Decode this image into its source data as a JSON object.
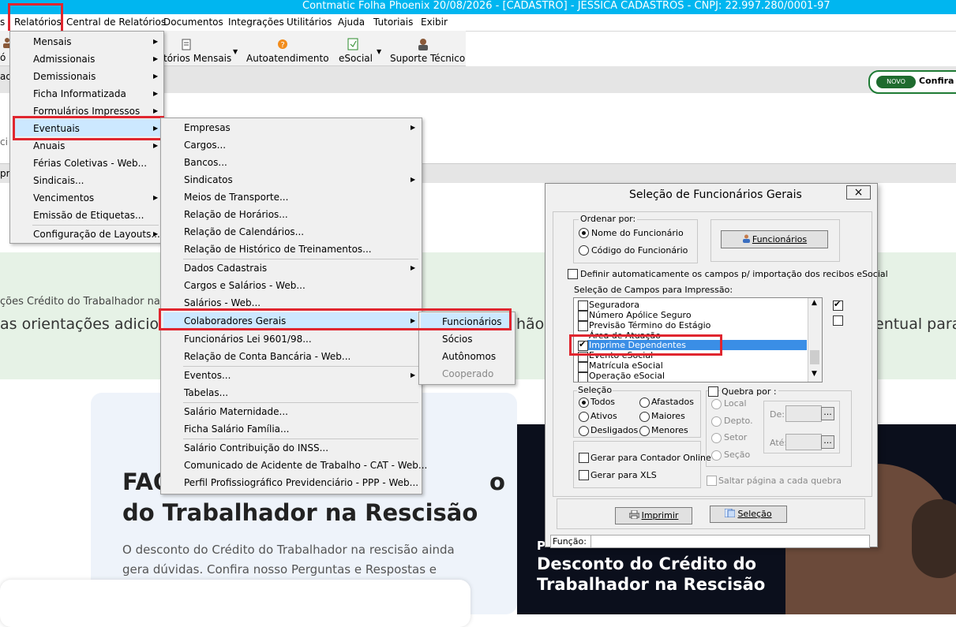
{
  "window": {
    "title": "Contmatic Folha Phoenix 20/08/2026 - [CADASTRO] - JESSICA CADASTROS - CNPJ: 22.997.280/0001-97"
  },
  "menubar": {
    "items": [
      "s",
      "Relatórios",
      "Central de Relatórios",
      "Documentos",
      "Integrações",
      "Utilitários",
      "Ajuda",
      "Tutoriais",
      "Exibir"
    ]
  },
  "toolbar": {
    "items": [
      "tórios Mensais",
      "Autoatendimento",
      "eSocial",
      "Suporte Técnico"
    ],
    "left_fragments": [
      "ó",
      "ad"
    ]
  },
  "novo": {
    "badge": "NOVO",
    "text": "Confira as"
  },
  "background": {
    "frag_ci": "ci",
    "frag_pr": "pr",
    "green_small": "ções Crédito do Trabalhador na",
    "green_big_left": "as orientações adicio",
    "green_big_mid": "hão",
    "green_big_right": "entual para",
    "faq_line1_left": "FAQ",
    "faq_line1_right": "o",
    "faq_line2": "do Trabalhador na Rescisão",
    "faq_p1": "O desconto do Crédito do Trabalhador na rescisão ainda",
    "faq_p2": "gera dúvidas. Confira nosso Perguntas e Respostas e",
    "ad_p": "P",
    "ad_line1": "Desconto do Crédito do",
    "ad_line2": "Trabalhador  na Rescisão"
  },
  "menu_relatorios": {
    "items": [
      "Mensais",
      "Admissionais",
      "Demissionais",
      "Ficha Informatizada",
      "Formulários Impressos",
      "Eventuais",
      "Anuais",
      "Férias Coletivas - Web...",
      "Sindicais...",
      "Vencimentos",
      "Emissão de Etiquetas...",
      "Configuração de Layouts..."
    ]
  },
  "menu_eventuais": {
    "items": [
      "Empresas",
      "Cargos...",
      "Bancos...",
      "Sindicatos",
      "Meios de Transporte...",
      "Relação de Horários...",
      "Relação de Calendários...",
      "Relação de Histórico de Treinamentos...",
      "Dados Cadastrais",
      "Cargos e Salários - Web...",
      "Salários - Web...",
      "Colaboradores Gerais",
      "Funcionários Lei 9601/98...",
      "Relação de Conta Bancária - Web...",
      "Eventos...",
      "Tabelas...",
      "Salário Maternidade...",
      "Ficha Salário Família...",
      "Salário Contribuição do INSS...",
      "Comunicado de Acidente de Trabalho - CAT - Web...",
      "Perfil Profissiográfico Previdenciário - PPP - Web..."
    ]
  },
  "menu_colaboradores": {
    "items": [
      "Funcionários",
      "Sócios",
      "Autônomos",
      "Cooperado"
    ]
  },
  "dialog": {
    "title": "Seleção de Funcionários Gerais",
    "close": "×",
    "ordenar_label": "Ordenar por:",
    "ordenar_options": [
      "Nome do Funcionário",
      "Código do Funcionário"
    ],
    "funcionarios_button": "Funcionários",
    "definir_label": "Definir automaticamente os campos p/ importação dos recibos eSocial",
    "campos_label": "Seleção de Campos para Impressão:",
    "campos": [
      "Seguradora",
      "Número Apólice Seguro",
      "Previsão Término do Estágio",
      "Área de Atuação",
      "Imprime Dependentes",
      "Evento eSocial",
      "Matrícula eSocial",
      "Operação eSocial"
    ],
    "selecao_label": "Seleção",
    "selecao_options": [
      "Todos",
      "Afastados",
      "Ativos",
      "Maiores",
      "Desligados",
      "Menores"
    ],
    "quebra_label": "Quebra por :",
    "quebra_options": [
      "Local",
      "Depto.",
      "Setor",
      "Seção"
    ],
    "de_label": "De:",
    "ate_label": "Até:",
    "ellipsis": "...",
    "gerar_contador": "Gerar para Contador Online",
    "gerar_xls": "Gerar para XLS",
    "saltar": "Saltar página a cada quebra",
    "imprimir": "Imprimir",
    "selecao_button": "Seleção",
    "funcao_label": "Função:"
  },
  "colors": {
    "titlebar": "#00b6f0",
    "highlight_red": "#e0262f",
    "menu_highlight": "#cce8ff",
    "selected_row": "#3a8ee6",
    "green_bg": "#e6f2e6"
  }
}
